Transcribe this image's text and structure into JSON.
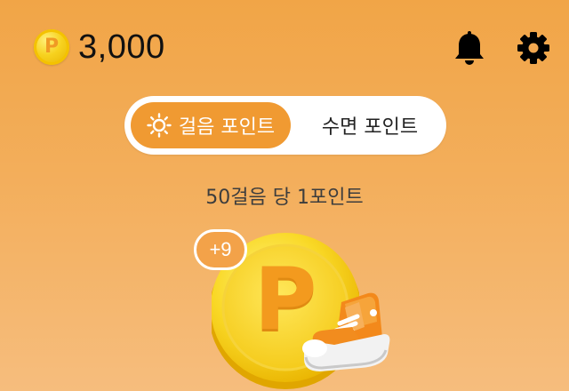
{
  "header": {
    "points_symbol": "P",
    "points_value": "3,000",
    "icons": [
      "coin-icon",
      "bell-icon",
      "gear-icon"
    ]
  },
  "toggle": {
    "tabs": [
      {
        "label": "걸음 포인트",
        "icon": "sun-icon",
        "selected": true
      },
      {
        "label": "수면 포인트",
        "selected": false
      }
    ]
  },
  "reward": {
    "rate_text": "50걸음 당 1포인트",
    "coin_symbol": "P",
    "badge_text": "+9",
    "illustrations": [
      "big-coin-icon",
      "sneaker-icon"
    ]
  },
  "colors": {
    "accent": "#f09a32",
    "coin": "#f7d21f",
    "background_top": "#f1a547",
    "background_bottom": "#f6bd7d"
  }
}
